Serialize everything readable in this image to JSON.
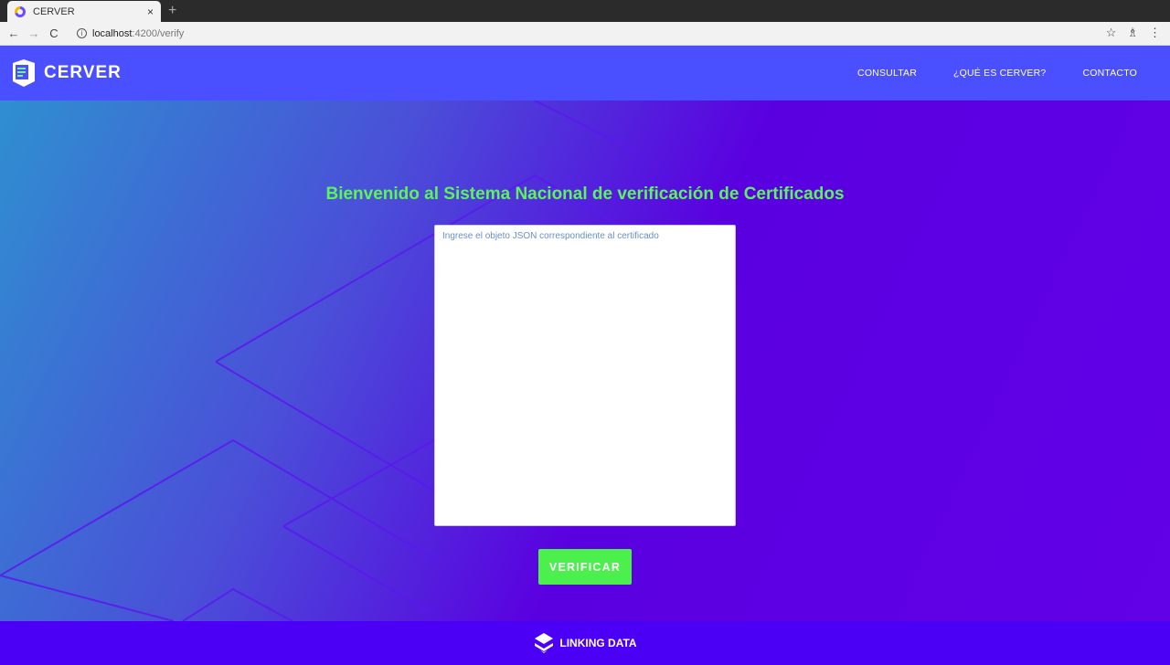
{
  "browser": {
    "tab_title": "CERVER",
    "tab_close": "×",
    "new_tab": "+",
    "back": "←",
    "forward": "→",
    "reload": "C",
    "url_host": "localhost",
    "url_path": ":4200/verify",
    "star": "☆",
    "extension": "♗"
  },
  "navbar": {
    "brand": "CERVER",
    "links": [
      "CONSULTAR",
      "¿QUÉ ES CERVER?",
      "CONTACTO"
    ],
    "color": "#4a4fff"
  },
  "hero": {
    "title": "Bienvenido al Sistema Nacional de verificación de Certificados",
    "textarea_placeholder": "Ingrese el objeto JSON correspondiente al certificado",
    "textarea_value": "",
    "button_label": "VERIFICAR",
    "accent_color": "#4cf04c"
  },
  "footer": {
    "brand": "LINKING DATA",
    "color": "#4b00f5"
  }
}
